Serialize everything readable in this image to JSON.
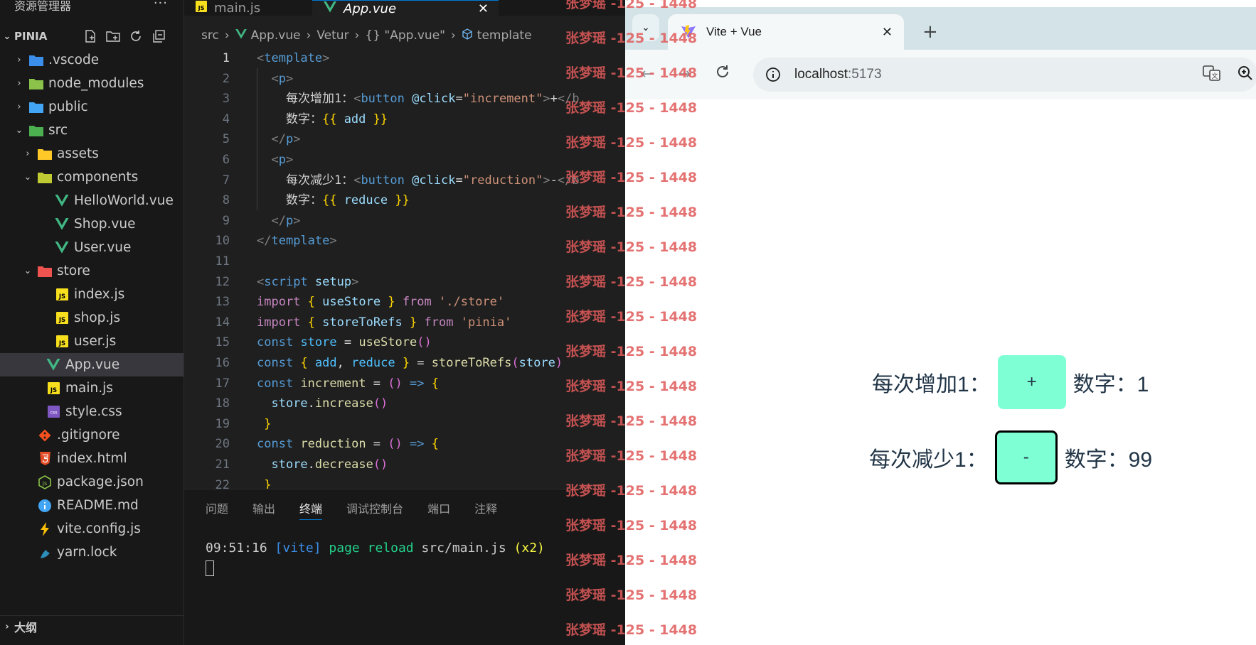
{
  "explorer": {
    "title": "资源管理器",
    "more": "···",
    "project": "PINIA",
    "outline": "大纲",
    "items": [
      {
        "label": ".vscode",
        "depth": 0,
        "kind": "folder",
        "expanded": false,
        "icon": "vscode-folder-icon",
        "color": "#3b8eea"
      },
      {
        "label": "node_modules",
        "depth": 0,
        "kind": "folder",
        "expanded": false,
        "icon": "node-folder-icon",
        "color": "#8bc34a"
      },
      {
        "label": "public",
        "depth": 0,
        "kind": "folder",
        "expanded": false,
        "icon": "public-folder-icon",
        "color": "#42a5f5"
      },
      {
        "label": "src",
        "depth": 0,
        "kind": "folder",
        "expanded": true,
        "icon": "src-folder-icon",
        "color": "#4caf50"
      },
      {
        "label": "assets",
        "depth": 1,
        "kind": "folder",
        "expanded": false,
        "icon": "assets-folder-icon",
        "color": "#ffca28"
      },
      {
        "label": "components",
        "depth": 1,
        "kind": "folder",
        "expanded": true,
        "icon": "components-folder-icon",
        "color": "#c0ca33"
      },
      {
        "label": "HelloWorld.vue",
        "depth": 2,
        "kind": "vue",
        "icon": "vue-file-icon",
        "color": "#41b883"
      },
      {
        "label": "Shop.vue",
        "depth": 2,
        "kind": "vue",
        "icon": "vue-file-icon",
        "color": "#41b883"
      },
      {
        "label": "User.vue",
        "depth": 2,
        "kind": "vue",
        "icon": "vue-file-icon",
        "color": "#41b883"
      },
      {
        "label": "store",
        "depth": 1,
        "kind": "folder",
        "expanded": true,
        "icon": "store-folder-icon",
        "color": "#ef5350"
      },
      {
        "label": "index.js",
        "depth": 2,
        "kind": "js",
        "icon": "js-file-icon",
        "color": "#f7df1e"
      },
      {
        "label": "shop.js",
        "depth": 2,
        "kind": "js",
        "icon": "js-file-icon",
        "color": "#f7df1e"
      },
      {
        "label": "user.js",
        "depth": 2,
        "kind": "js",
        "icon": "js-file-icon",
        "color": "#f7df1e"
      },
      {
        "label": "App.vue",
        "depth": 1,
        "kind": "vue",
        "icon": "vue-file-icon",
        "color": "#41b883",
        "selected": true
      },
      {
        "label": "main.js",
        "depth": 1,
        "kind": "js",
        "icon": "js-file-icon",
        "color": "#f7df1e"
      },
      {
        "label": "style.css",
        "depth": 1,
        "kind": "css",
        "icon": "css-file-icon",
        "color": "#7e57c2"
      },
      {
        "label": ".gitignore",
        "depth": 0,
        "kind": "git",
        "icon": "git-icon",
        "color": "#f4511e"
      },
      {
        "label": "index.html",
        "depth": 0,
        "kind": "html",
        "icon": "html-file-icon",
        "color": "#e44d26"
      },
      {
        "label": "package.json",
        "depth": 0,
        "kind": "node",
        "icon": "nodejs-icon",
        "color": "#8bc34a"
      },
      {
        "label": "README.md",
        "depth": 0,
        "kind": "info",
        "icon": "info-icon",
        "color": "#42a5f5"
      },
      {
        "label": "vite.config.js",
        "depth": 0,
        "kind": "vite",
        "icon": "vite-bolt-icon",
        "color": "#ffc107"
      },
      {
        "label": "yarn.lock",
        "depth": 0,
        "kind": "yarn",
        "icon": "yarn-icon",
        "color": "#2c8ebb"
      }
    ]
  },
  "editor": {
    "tabs": [
      {
        "label": "main.js",
        "icon": "js-file-icon",
        "active": false
      },
      {
        "label": "App.vue",
        "icon": "vue-file-icon",
        "active": true,
        "close": "✕"
      }
    ],
    "breadcrumbs": [
      "src",
      "App.vue",
      "Vetur",
      "{} \"App.vue\"",
      "template"
    ],
    "lines": [
      [
        [
          "brk",
          "<"
        ],
        [
          "kw-tag",
          "template"
        ],
        [
          "brk",
          ">"
        ]
      ],
      [
        [
          "plain",
          "  "
        ],
        [
          "brk",
          "<"
        ],
        [
          "kw-tag",
          "p"
        ],
        [
          "brk",
          ">"
        ]
      ],
      [
        [
          "plain",
          "    每次增加1："
        ],
        [
          "brk",
          "<"
        ],
        [
          "kw-tag",
          "button"
        ],
        [
          "plain",
          " "
        ],
        [
          "attr",
          "@click"
        ],
        [
          "plain",
          "="
        ],
        [
          "str",
          "\"increment\""
        ],
        [
          "brk",
          ">"
        ],
        [
          "plain",
          "+"
        ],
        [
          "brk",
          "</b"
        ]
      ],
      [
        [
          "plain",
          "    数字："
        ],
        [
          "brace",
          "{{"
        ],
        [
          "plain",
          " "
        ],
        [
          "var",
          "add"
        ],
        [
          "plain",
          " "
        ],
        [
          "brace",
          "}}"
        ]
      ],
      [
        [
          "plain",
          "  "
        ],
        [
          "brk",
          "</"
        ],
        [
          "kw-tag",
          "p"
        ],
        [
          "brk",
          ">"
        ]
      ],
      [
        [
          "plain",
          "  "
        ],
        [
          "brk",
          "<"
        ],
        [
          "kw-tag",
          "p"
        ],
        [
          "brk",
          ">"
        ]
      ],
      [
        [
          "plain",
          "    每次减少1："
        ],
        [
          "brk",
          "<"
        ],
        [
          "kw-tag",
          "button"
        ],
        [
          "plain",
          " "
        ],
        [
          "attr",
          "@click"
        ],
        [
          "plain",
          "="
        ],
        [
          "str",
          "\"reduction\""
        ],
        [
          "brk",
          ">"
        ],
        [
          "plain",
          "-"
        ],
        [
          "brk",
          "</b"
        ]
      ],
      [
        [
          "plain",
          "    数字："
        ],
        [
          "brace",
          "{{"
        ],
        [
          "plain",
          " "
        ],
        [
          "var",
          "reduce"
        ],
        [
          "plain",
          " "
        ],
        [
          "brace",
          "}}"
        ]
      ],
      [
        [
          "plain",
          "  "
        ],
        [
          "brk",
          "</"
        ],
        [
          "kw-tag",
          "p"
        ],
        [
          "brk",
          ">"
        ]
      ],
      [
        [
          "brk",
          "</"
        ],
        [
          "kw-tag",
          "template"
        ],
        [
          "brk",
          ">"
        ]
      ],
      [],
      [
        [
          "brk",
          "<"
        ],
        [
          "kw-tag",
          "script"
        ],
        [
          "plain",
          " "
        ],
        [
          "attr",
          "setup"
        ],
        [
          "brk",
          ">"
        ]
      ],
      [
        [
          "imp",
          "import"
        ],
        [
          "plain",
          " "
        ],
        [
          "brace",
          "{"
        ],
        [
          "plain",
          " "
        ],
        [
          "var",
          "useStore"
        ],
        [
          "plain",
          " "
        ],
        [
          "brace",
          "}"
        ],
        [
          "plain",
          " "
        ],
        [
          "imp",
          "from"
        ],
        [
          "plain",
          " "
        ],
        [
          "str",
          "'./store'"
        ]
      ],
      [
        [
          "imp",
          "import"
        ],
        [
          "plain",
          " "
        ],
        [
          "brace",
          "{"
        ],
        [
          "plain",
          " "
        ],
        [
          "var",
          "storeToRefs"
        ],
        [
          "plain",
          " "
        ],
        [
          "brace",
          "}"
        ],
        [
          "plain",
          " "
        ],
        [
          "imp",
          "from"
        ],
        [
          "plain",
          " "
        ],
        [
          "str",
          "'pinia'"
        ]
      ],
      [
        [
          "kw",
          "const"
        ],
        [
          "plain",
          " "
        ],
        [
          "cn",
          "store"
        ],
        [
          "plain",
          " = "
        ],
        [
          "fn",
          "useStore"
        ],
        [
          "brace2",
          "()"
        ]
      ],
      [
        [
          "kw",
          "const"
        ],
        [
          "plain",
          " "
        ],
        [
          "brace",
          "{"
        ],
        [
          "plain",
          " "
        ],
        [
          "cn",
          "add"
        ],
        [
          "plain",
          ", "
        ],
        [
          "cn",
          "reduce"
        ],
        [
          "plain",
          " "
        ],
        [
          "brace",
          "}"
        ],
        [
          "plain",
          " = "
        ],
        [
          "fn",
          "storeToRefs"
        ],
        [
          "brace2",
          "("
        ],
        [
          "var",
          "store"
        ],
        [
          "brace2",
          ")"
        ]
      ],
      [
        [
          "kw",
          "const"
        ],
        [
          "plain",
          " "
        ],
        [
          "fn",
          "increment"
        ],
        [
          "plain",
          " = "
        ],
        [
          "brace2",
          "()"
        ],
        [
          "plain",
          " "
        ],
        [
          "kw",
          "=>"
        ],
        [
          "plain",
          " "
        ],
        [
          "brace",
          "{"
        ]
      ],
      [
        [
          "plain",
          "  "
        ],
        [
          "var",
          "store"
        ],
        [
          "plain",
          "."
        ],
        [
          "fn",
          "increase"
        ],
        [
          "brace2",
          "()"
        ]
      ],
      [
        [
          "plain",
          " "
        ],
        [
          "brace",
          "}"
        ]
      ],
      [
        [
          "kw",
          "const"
        ],
        [
          "plain",
          " "
        ],
        [
          "fn",
          "reduction"
        ],
        [
          "plain",
          " = "
        ],
        [
          "brace2",
          "()"
        ],
        [
          "plain",
          " "
        ],
        [
          "kw",
          "=>"
        ],
        [
          "plain",
          " "
        ],
        [
          "brace",
          "{"
        ]
      ],
      [
        [
          "plain",
          "  "
        ],
        [
          "var",
          "store"
        ],
        [
          "plain",
          "."
        ],
        [
          "fn",
          "decrease"
        ],
        [
          "brace2",
          "()"
        ]
      ],
      [
        [
          "plain",
          " "
        ],
        [
          "brace",
          "}"
        ]
      ]
    ],
    "current_line": 1
  },
  "panel": {
    "tabs": [
      "问题",
      "输出",
      "终端",
      "调试控制台",
      "端口",
      "注释"
    ],
    "active_tab": "终端",
    "terminal": {
      "time": "09:51:16",
      "tag": "[vite]",
      "msg": "page reload",
      "path": "src/main.js",
      "count": "(x2)"
    }
  },
  "browser": {
    "tab_title": "Vite + Vue",
    "tab_close": "✕",
    "new_tab": "+",
    "url_host": "localhost",
    "url_port": ":5173",
    "page": {
      "row1_label": "每次增加1：",
      "row1_button": "+",
      "row1_count": "数字：1",
      "row2_label": "每次减少1：",
      "row2_button": "-",
      "row2_count": "数字：99"
    },
    "colors": {
      "button_bg": "#7fffd4",
      "text": "#213547"
    }
  },
  "watermark": {
    "text": "张梦瑶 -125 - 1448",
    "count": 19
  }
}
